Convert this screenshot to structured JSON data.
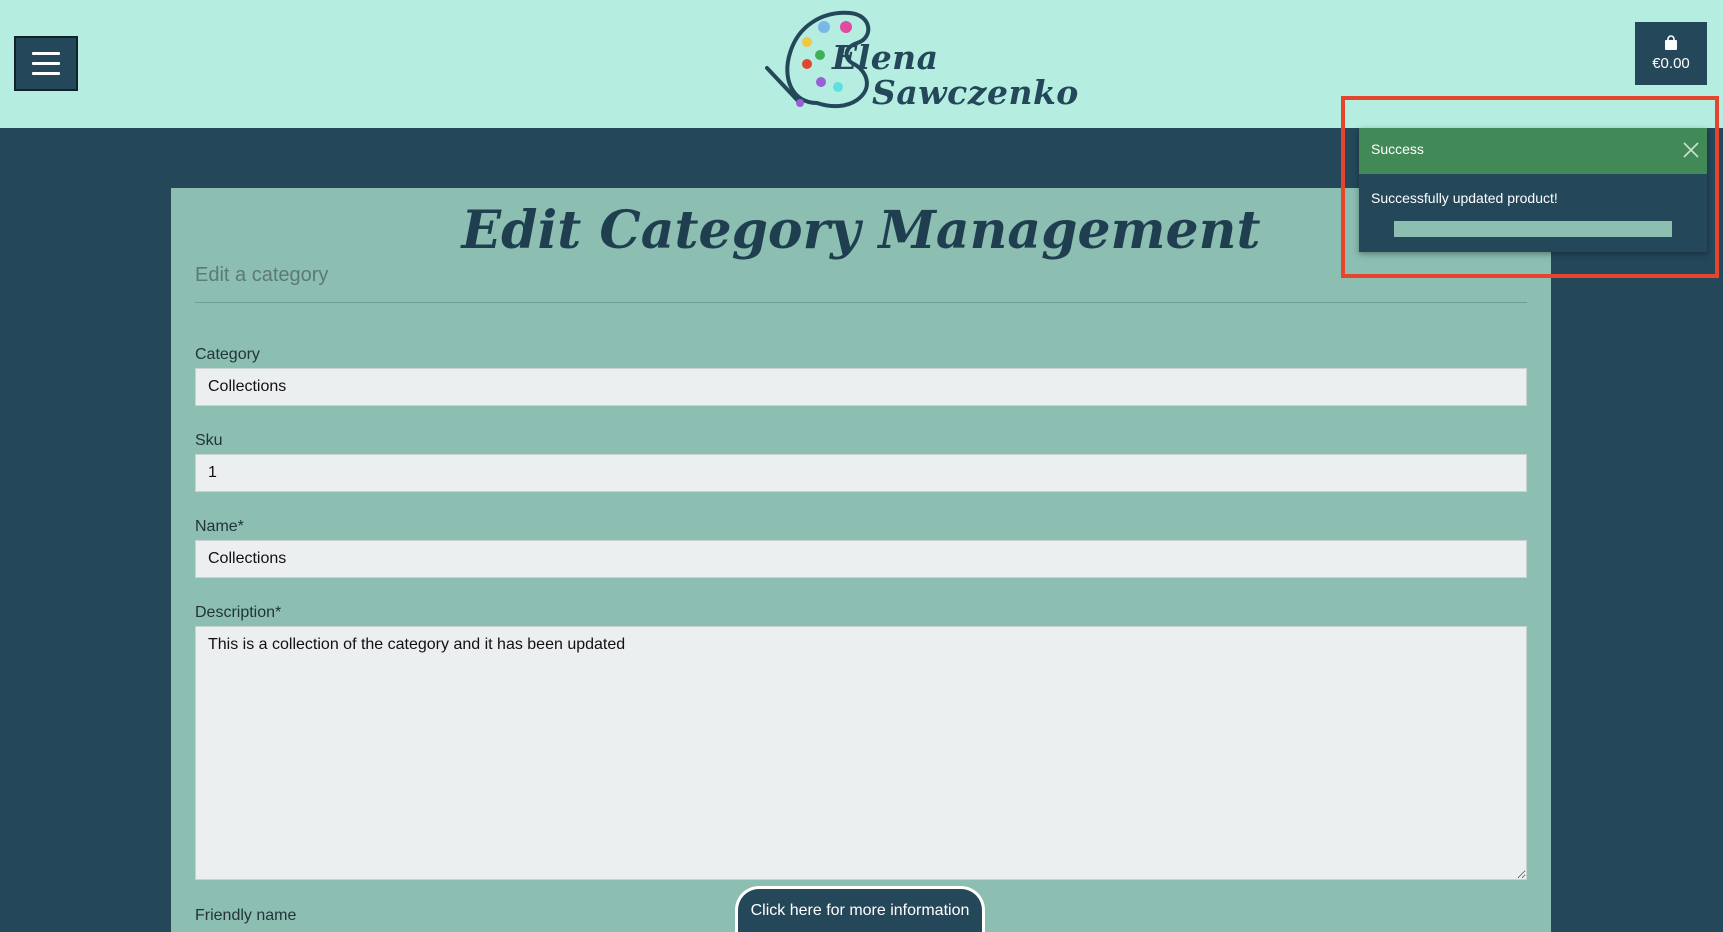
{
  "header": {
    "logo_line1": "Elena",
    "logo_line2": "Sawczenko",
    "cart_total": "€0.00"
  },
  "page": {
    "title": "Edit Category Management",
    "subtitle": "Edit a category"
  },
  "form": {
    "category_label": "Category",
    "category_value": "Collections",
    "sku_label": "Sku",
    "sku_value": "1",
    "name_label": "Name*",
    "name_value": "Collections",
    "description_label": "Description*",
    "description_value": "This is a collection of the category and it has been updated",
    "friendly_name_label": "Friendly name"
  },
  "info_button": "Click here for more information",
  "toast": {
    "title": "Success",
    "message": "Successfully updated product!",
    "progress": 1.0
  },
  "colors": {
    "header_bg": "#b5eee1",
    "page_bg": "#24475a",
    "card_bg": "#8cbeb1",
    "toast_success": "#418a57",
    "highlight": "#e5452f"
  }
}
